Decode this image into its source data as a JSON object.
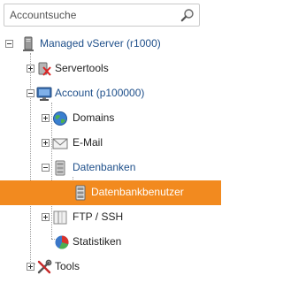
{
  "search": {
    "placeholder": "Accountsuche"
  },
  "tree": {
    "server": {
      "label": "Managed vServer (r1000)"
    },
    "servertools": {
      "label": "Servertools"
    },
    "account": {
      "label": "Account (p100000)"
    },
    "domains": {
      "label": "Domains"
    },
    "email": {
      "label": "E-Mail"
    },
    "datenbanken": {
      "label": "Datenbanken"
    },
    "datenbankbenutzer": {
      "label": "Datenbankbenutzer"
    },
    "ftp": {
      "label": "FTP / SSH"
    },
    "statistiken": {
      "label": "Statistiken"
    },
    "tools": {
      "label": "Tools"
    }
  },
  "colors": {
    "selected_bg": "#f28a1f",
    "link_blue": "#1e4f8a"
  }
}
